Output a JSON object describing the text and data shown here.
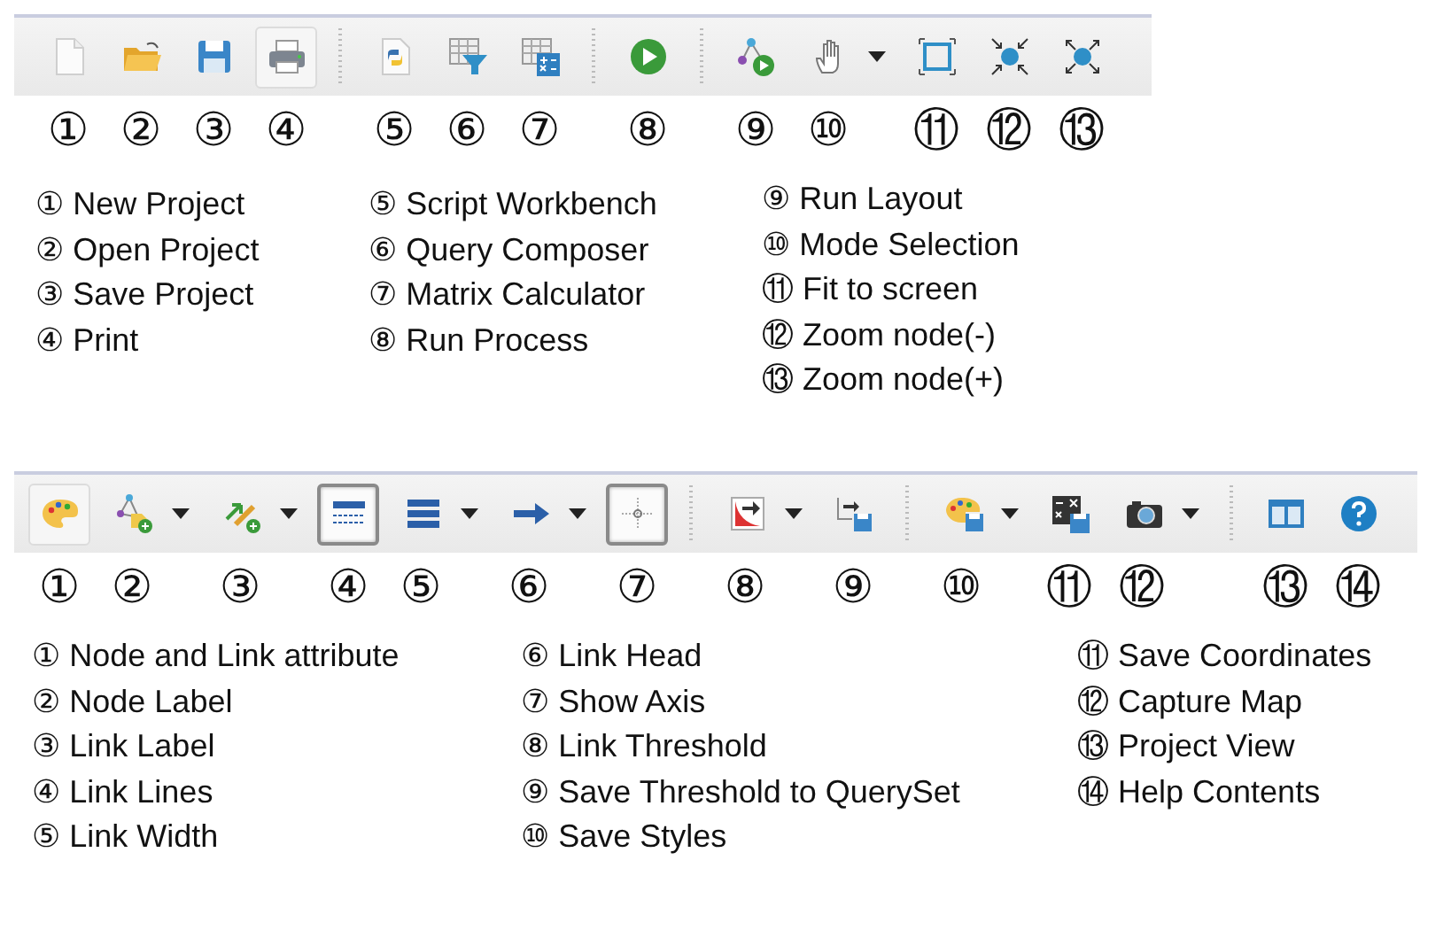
{
  "toolbars": [
    {
      "tools": [
        {
          "kind": "button",
          "number": "①",
          "dropdown": false,
          "pressed": false,
          "hover": false
        },
        {
          "kind": "button",
          "number": "②",
          "dropdown": false,
          "pressed": false,
          "hover": false
        },
        {
          "kind": "button",
          "number": "③",
          "dropdown": false,
          "pressed": false,
          "hover": false
        },
        {
          "kind": "button",
          "number": "④",
          "dropdown": false,
          "pressed": false,
          "hover": true
        },
        {
          "kind": "separator"
        },
        {
          "kind": "button",
          "number": "⑤",
          "dropdown": false,
          "pressed": false,
          "hover": false
        },
        {
          "kind": "button",
          "number": "⑥",
          "dropdown": false,
          "pressed": false,
          "hover": false
        },
        {
          "kind": "button",
          "number": "⑦",
          "dropdown": false,
          "pressed": false,
          "hover": false
        },
        {
          "kind": "separator"
        },
        {
          "kind": "button",
          "number": "⑧",
          "dropdown": false,
          "pressed": false,
          "hover": false
        },
        {
          "kind": "separator"
        },
        {
          "kind": "button",
          "number": "⑨",
          "dropdown": false,
          "pressed": false,
          "hover": false
        },
        {
          "kind": "button",
          "number": "⑩",
          "dropdown": true,
          "pressed": false,
          "hover": false
        },
        {
          "kind": "button",
          "number": "⑪",
          "dropdown": false,
          "pressed": false,
          "hover": false
        },
        {
          "kind": "button",
          "number": "⑫",
          "dropdown": false,
          "pressed": false,
          "hover": false
        },
        {
          "kind": "button",
          "number": "⑬",
          "dropdown": false,
          "pressed": false,
          "hover": false
        }
      ],
      "legend": [
        [
          "① New Project",
          "② Open Project",
          "③ Save Project",
          "④ Print"
        ],
        [
          "⑤ Script Workbench",
          "⑥ Query Composer",
          "⑦ Matrix Calculator",
          "⑧ Run Process"
        ],
        [
          "⑨ Run Layout",
          "⑩ Mode Selection",
          "⑪ Fit to screen",
          "⑫ Zoom node(-)",
          "⑬ Zoom node(+)"
        ]
      ]
    },
    {
      "tools": [
        {
          "kind": "button",
          "number": "①",
          "dropdown": false,
          "pressed": false,
          "hover": true
        },
        {
          "kind": "button",
          "number": "②",
          "dropdown": true,
          "pressed": false,
          "hover": false
        },
        {
          "kind": "button",
          "number": "③",
          "dropdown": true,
          "pressed": false,
          "hover": false
        },
        {
          "kind": "button",
          "number": "④",
          "dropdown": false,
          "pressed": true,
          "hover": false
        },
        {
          "kind": "button",
          "number": "⑤",
          "dropdown": true,
          "pressed": false,
          "hover": false
        },
        {
          "kind": "button",
          "number": "⑥",
          "dropdown": true,
          "pressed": false,
          "hover": false
        },
        {
          "kind": "button",
          "number": "⑦",
          "dropdown": false,
          "pressed": true,
          "hover": false
        },
        {
          "kind": "separator"
        },
        {
          "kind": "button",
          "number": "⑧",
          "dropdown": true,
          "pressed": false,
          "hover": false
        },
        {
          "kind": "button",
          "number": "⑨",
          "dropdown": false,
          "pressed": false,
          "hover": false
        },
        {
          "kind": "separator"
        },
        {
          "kind": "button",
          "number": "⑩",
          "dropdown": true,
          "pressed": false,
          "hover": false
        },
        {
          "kind": "button",
          "number": "⑪",
          "dropdown": false,
          "pressed": false,
          "hover": false
        },
        {
          "kind": "button",
          "number": "⑫",
          "dropdown": true,
          "pressed": false,
          "hover": false
        },
        {
          "kind": "separator"
        },
        {
          "kind": "button",
          "number": "⑬",
          "dropdown": false,
          "pressed": false,
          "hover": false
        },
        {
          "kind": "button",
          "number": "⑭",
          "dropdown": false,
          "pressed": false,
          "hover": false
        }
      ],
      "legend": [
        [
          "① Node and Link attribute",
          "② Node Label",
          "③ Link Label",
          "④ Link Lines",
          "⑤ Link Width"
        ],
        [
          "⑥ Link Head",
          "⑦ Show Axis",
          "⑧ Link Threshold",
          "⑨ Save Threshold to QuerySet",
          "⑩ Save Styles"
        ],
        [
          "⑪ Save Coordinates",
          "⑫ Capture Map",
          "⑬ Project View",
          "⑭ Help Contents"
        ]
      ]
    }
  ]
}
